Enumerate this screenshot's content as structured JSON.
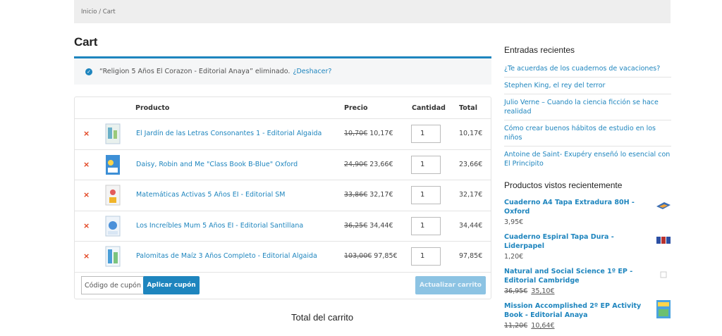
{
  "breadcrumb": "Inicio / Cart",
  "page_title": "Cart",
  "notice": {
    "message": "“Religion 5 Años El Corazon - Editorial Anaya” eliminado.",
    "undo_label": "¿Deshacer?"
  },
  "table": {
    "headers": {
      "product": "Producto",
      "price": "Precio",
      "quantity": "Cantidad",
      "total": "Total"
    },
    "rows": [
      {
        "name": "El Jardín de las Letras Consonantes 1 - Editorial Algaida",
        "old_price": "10,70€",
        "price": "10,17€",
        "qty": "1",
        "total": "10,17€"
      },
      {
        "name": "Daisy, Robin and Me \"Class Book B-Blue\" Oxford",
        "old_price": "24,90€",
        "price": "23,66€",
        "qty": "1",
        "total": "23,66€"
      },
      {
        "name": "Matemáticas Activas 5 Años EI - Editorial SM",
        "old_price": "33,86€",
        "price": "32,17€",
        "qty": "1",
        "total": "32,17€"
      },
      {
        "name": "Los Increíbles Mum 5 Años EI - Editorial Santillana",
        "old_price": "36,25€",
        "price": "34,44€",
        "qty": "1",
        "total": "34,44€"
      },
      {
        "name": "Palomitas de Maíz 3 Años Completo - Editorial Algaida",
        "old_price": "103,00€",
        "price": "97,85€",
        "qty": "1",
        "total": "97,85€"
      }
    ],
    "remove_symbol": "×",
    "coupon_placeholder": "Código de cupón",
    "apply_coupon": "Aplicar cupón",
    "update_cart": "Actualizar carrito"
  },
  "totals_title": "Total del carrito",
  "sidebar": {
    "recent_title": "Entradas recientes",
    "recent_posts": [
      "¿Te acuerdas de los cuadernos de vacaciones?",
      "Stephen King, el rey del terror",
      "Julio Verne – Cuando la ciencia ficción se hace realidad",
      "Cómo crear buenos hábitos de estudio en los niños",
      "Antoine de Saint- Exupéry enseñó lo esencial con El Principito"
    ],
    "viewed_title": "Productos vistos recientemente",
    "viewed_products": [
      {
        "name": "Cuaderno A4 Tapa Extradura 80H - Oxford",
        "old_price": "",
        "price": "3,95€"
      },
      {
        "name": "Cuaderno Espiral Tapa Dura - Liderpapel",
        "old_price": "",
        "price": "1,20€"
      },
      {
        "name": "Natural and Social Science 1º EP - Editorial Cambridge",
        "old_price": "36,95€",
        "price": "35,10€"
      },
      {
        "name": "Mission Accomplished 2º EP Activity Book - Editorial Anaya",
        "old_price": "11,20€",
        "price": "10,64€"
      }
    ]
  },
  "colors": {
    "accent": "#1e85be",
    "remove": "#e2401c",
    "update_disabled": "#8cc3e3"
  }
}
